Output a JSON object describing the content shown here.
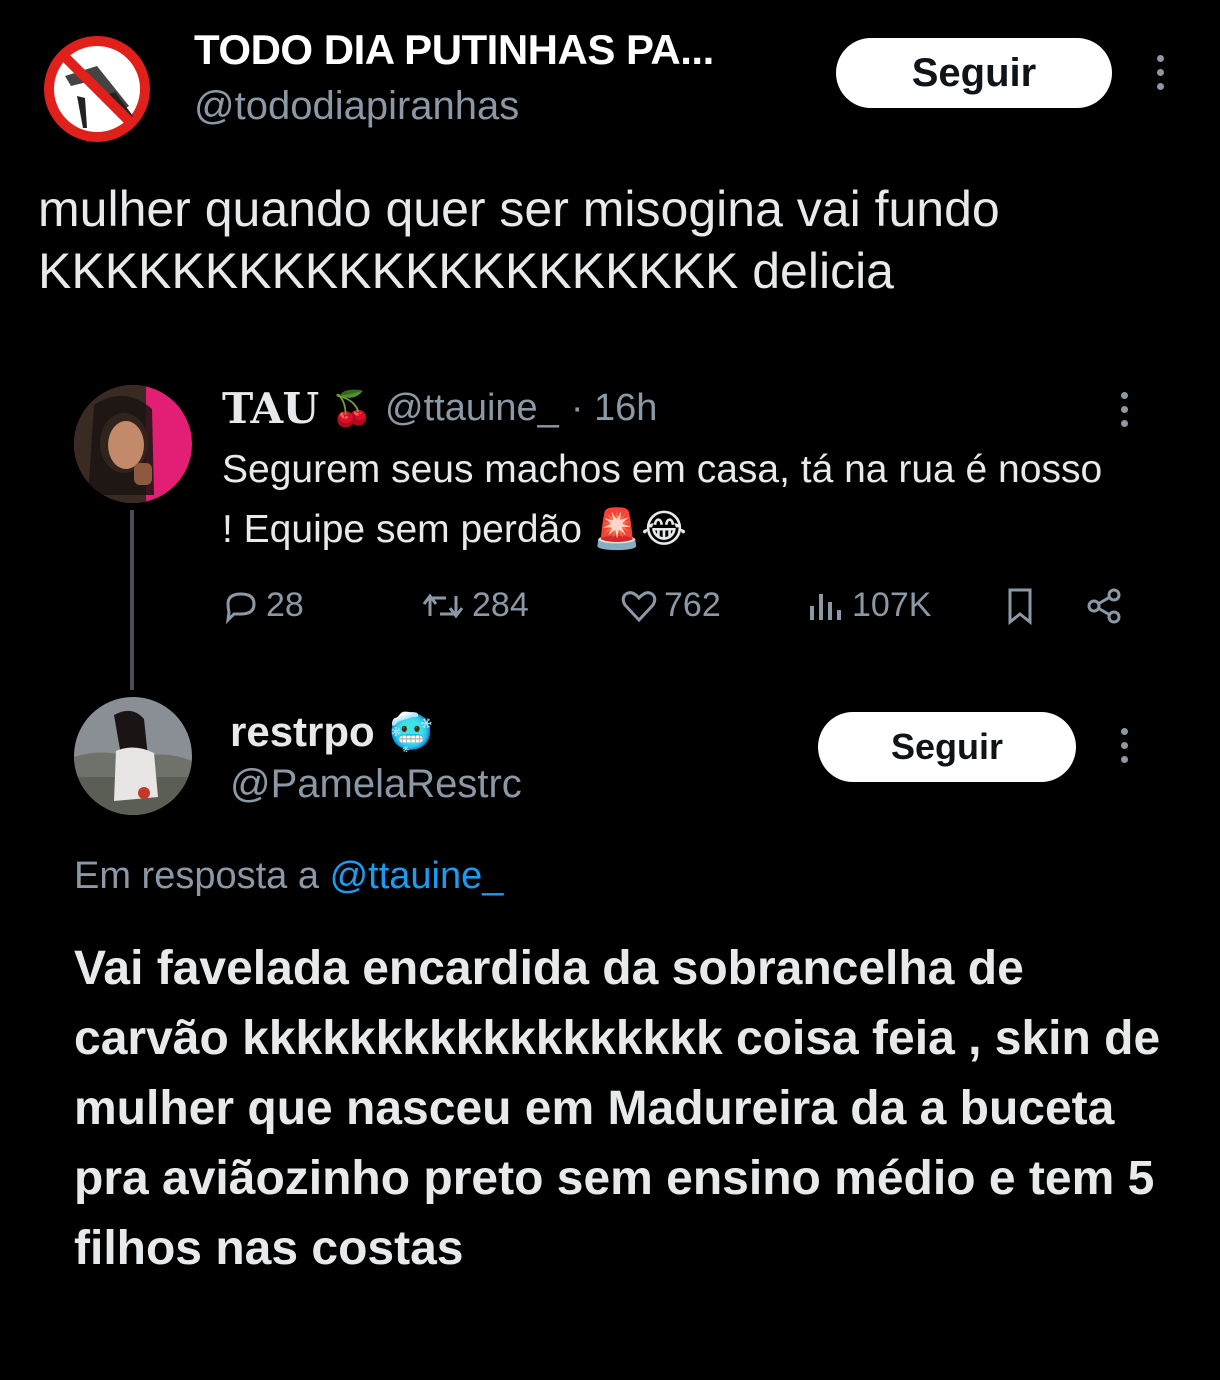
{
  "top_post": {
    "display_name": "TODO DIA PUTINHAS PA...",
    "handle": "@tododiapiranhas",
    "follow_label": "Seguir",
    "text": "mulher quando quer ser misogina vai fundo KKKKKKKKKKKKKKKKKKKKK delicia"
  },
  "quoted_tweet": {
    "display_name": "TAU",
    "name_emoji": "🍒",
    "handle": "@ttauine_",
    "time": "· 16h",
    "text": "Segurem seus machos em casa, tá na rua é nosso ! Equipe sem perdão 🚨😂",
    "metrics": {
      "replies": "28",
      "retweets": "284",
      "likes": "762",
      "views": "107K"
    }
  },
  "reply": {
    "display_name": "restrpo",
    "name_emoji": "🥶",
    "handle": "@PamelaRestrc",
    "follow_label": "Seguir",
    "reply_prefix": "Em resposta a",
    "reply_target": "@ttauine_",
    "text": "Vai favelada encardida da sobrancelha de carvão kkkkkkkkkkkkkkkkkk coisa feia , skin de mulher que nasceu em Madureira da a buceta pra aviãozinho preto sem ensino médio e tem 5 filhos nas costas"
  },
  "colors": {
    "background": "#000000",
    "text": "#e7e9ea",
    "muted": "#8b98a5",
    "link": "#1d9bf0",
    "button_bg": "#ffffff"
  }
}
